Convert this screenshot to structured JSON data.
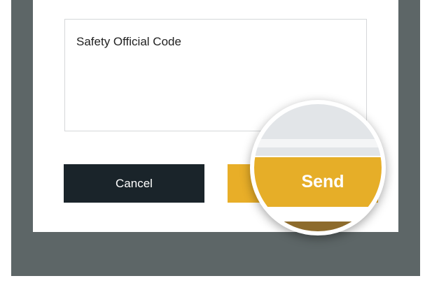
{
  "dialog": {
    "textarea": {
      "value": "Safety Official Code"
    },
    "buttons": {
      "cancel_label": "Cancel",
      "send_label": "Send"
    }
  },
  "magnifier": {
    "label": "Send"
  },
  "colors": {
    "backdrop": "#5d6667",
    "cancel_bg": "#1a242a",
    "send_bg": "#e8ae28"
  }
}
